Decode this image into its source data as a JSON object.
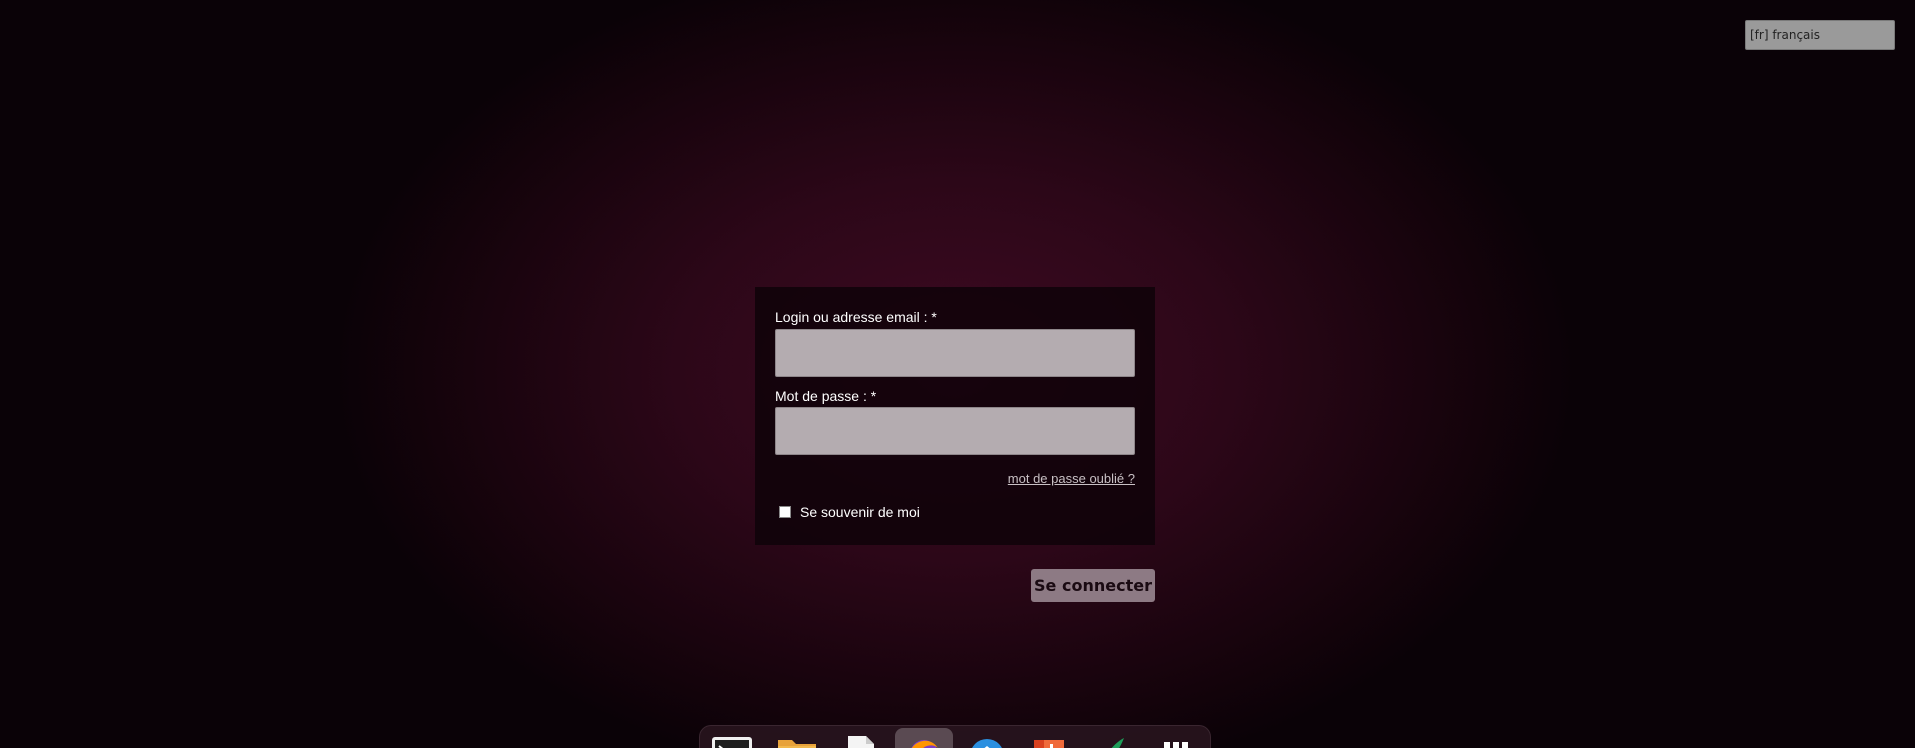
{
  "language_selector": {
    "value": "[fr] français"
  },
  "login_form": {
    "login_label": "Login ou adresse email : *",
    "login_value": "",
    "password_label": "Mot de passe : *",
    "password_value": "",
    "forgot_password_link": "mot de passe oublié ?",
    "remember_me_label": "Se souvenir de moi",
    "remember_me_checked": false,
    "submit_label": "Se connecter"
  },
  "dock": {
    "items": [
      {
        "icon": "terminal-icon"
      },
      {
        "icon": "folder-icon"
      },
      {
        "icon": "document-icon"
      },
      {
        "icon": "firefox-icon",
        "active": true
      },
      {
        "icon": "thunderbird-icon"
      },
      {
        "icon": "office-icon"
      },
      {
        "icon": "quill-icon"
      },
      {
        "icon": "app-grid-icon"
      }
    ]
  },
  "colors": {
    "background_center": "#3e0a22",
    "background_edge": "#0a0207",
    "input_background": "#b4acb0",
    "button_background": "#8d7a84"
  }
}
